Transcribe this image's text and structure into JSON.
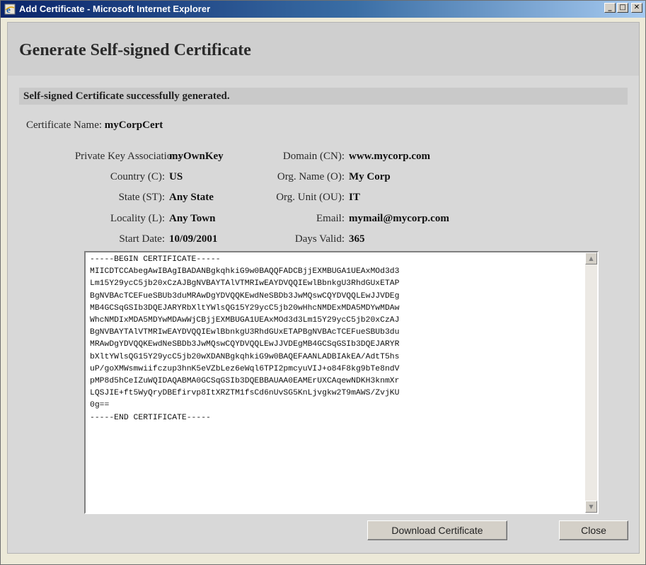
{
  "window": {
    "title": "Add Certificate - Microsoft Internet Explorer",
    "controls": {
      "minimize": "_",
      "maximize": "□",
      "close": "✕"
    }
  },
  "page": {
    "title": "Generate Self-signed Certificate",
    "status": "Self-signed Certificate successfully generated."
  },
  "fields": {
    "certificate_name": {
      "label": "Certificate Name:",
      "value": "myCorpCert"
    },
    "private_key": {
      "label": "Private Key Association:",
      "value": "myOwnKey"
    },
    "domain": {
      "label": "Domain (CN):",
      "value": "www.mycorp.com"
    },
    "country": {
      "label": "Country (C):",
      "value": "US"
    },
    "org_name": {
      "label": "Org. Name (O):",
      "value": "My Corp"
    },
    "state": {
      "label": "State (ST):",
      "value": "Any State"
    },
    "org_unit": {
      "label": "Org. Unit (OU):",
      "value": "IT"
    },
    "locality": {
      "label": "Locality (L):",
      "value": "Any Town"
    },
    "email": {
      "label": "Email:",
      "value": "mymail@mycorp.com"
    },
    "start_date": {
      "label": "Start Date:",
      "value": "10/09/2001"
    },
    "days_valid": {
      "label": "Days Valid:",
      "value": "365"
    }
  },
  "certificate": {
    "text": "-----BEGIN CERTIFICATE-----\nMIICDTCCAbegAwIBAgIBADANBgkqhkiG9w0BAQQFADCBjjEXMBUGA1UEAxMOd3d3\nLm15Y29ycC5jb20xCzAJBgNVBAYTAlVTMRIwEAYDVQQIEwlBbnkgU3RhdGUxETAP\nBgNVBAcTCEFueSBUb3duMRAwDgYDVQQKEwdNeSBDb3JwMQswCQYDVQQLEwJJVDEg\nMB4GCSqGSIb3DQEJARYRbXltYWlsQG15Y29ycC5jb20wHhcNMDExMDA5MDYwMDAw\nWhcNMDIxMDA5MDYwMDAwWjCBjjEXMBUGA1UEAxMOd3d3Lm15Y29ycC5jb20xCzAJ\nBgNVBAYTAlVTMRIwEAYDVQQIEwlBbnkgU3RhdGUxETAPBgNVBAcTCEFueSBUb3du\nMRAwDgYDVQQKEwdNeSBDb3JwMQswCQYDVQQLEwJJVDEgMB4GCSqGSIb3DQEJARYR\nbXltYWlsQG15Y29ycC5jb20wXDANBgkqhkiG9w0BAQEFAANLADBIAkEA/AdtT5hs\nuP/goXMWsmwiifczup3hnK5eVZbLez6eWql6TPI2pmcyuVIJ+o84F8kg9bTe8ndV\npMP8d5hCeIZuWQIDAQABMA0GCSqGSIb3DQEBBAUAA0EAMErUXCAqewNDKH3knmXr\nLQSJIE+ft5WyQryDBEfirvp8ItXRZTM1fsCd6nUvSG5KnLjvgkw2T9mAWS/ZvjKU\n0g==\n-----END CERTIFICATE-----"
  },
  "buttons": {
    "download": "Download Certificate",
    "close": "Close"
  }
}
